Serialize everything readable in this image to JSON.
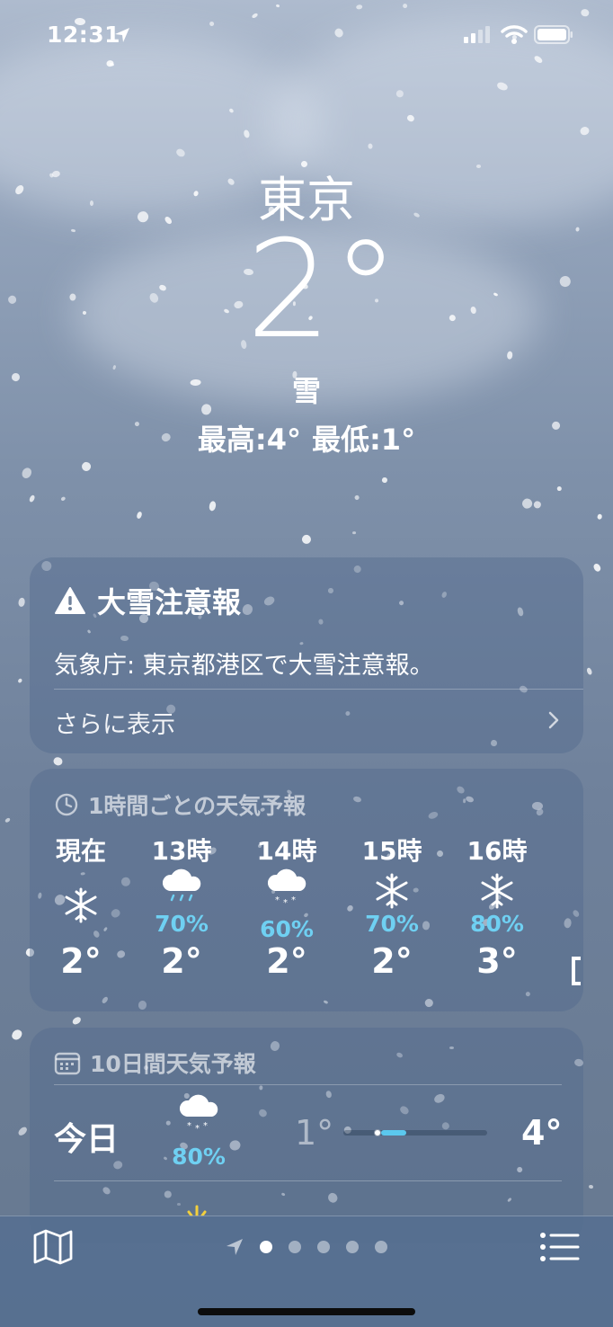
{
  "status_bar": {
    "time": "12:31"
  },
  "current": {
    "city": "東京",
    "temperature": "2°",
    "condition": "雪",
    "high": "最高:4°",
    "low": "最低:1°"
  },
  "alert": {
    "title": "大雪注意報",
    "text": "気象庁: 東京都港区で大雪注意報。",
    "more_label": "さらに表示"
  },
  "hourly": {
    "label": "1時間ごとの天気予報",
    "items": [
      {
        "time": "現在",
        "icon": "snowflake-icon",
        "precip": "",
        "temp": "2°"
      },
      {
        "time": "13時",
        "icon": "sleet-cloud-icon",
        "precip": "70%",
        "temp": "2°"
      },
      {
        "time": "14時",
        "icon": "snow-cloud-icon",
        "precip": "60%",
        "temp": "2°"
      },
      {
        "time": "15時",
        "icon": "snowflake-icon",
        "precip": "70%",
        "temp": "2°"
      },
      {
        "time": "16時",
        "icon": "snowflake-icon",
        "precip": "80%",
        "temp": "3°"
      }
    ]
  },
  "daily": {
    "label": "10日間天気予報",
    "rows": [
      {
        "day": "今日",
        "icon": "snow-cloud-icon",
        "precip": "80%",
        "low": "1°",
        "high": "4°",
        "current_position": 0.21
      }
    ]
  },
  "pager": {
    "page_count": 5,
    "active_index": 0
  },
  "colors": {
    "precip_blue": "#6fd0f2",
    "bar_fill": "#5bc8ee"
  }
}
